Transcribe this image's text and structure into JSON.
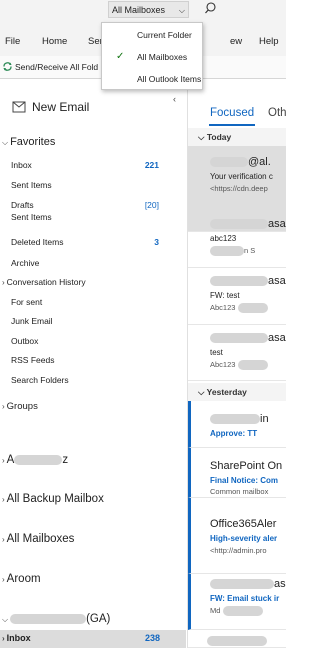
{
  "topbar": {
    "scope_label": "All Mailboxes",
    "scope_chevron": "chevron-down-icon",
    "search_icon": "search-icon"
  },
  "ribbon": {
    "tabs": [
      "File",
      "Home",
      "Sen",
      "ew",
      "Help"
    ],
    "send_receive_label": "Send/Receive All Fold"
  },
  "dropdown": {
    "items": [
      {
        "label": "Current Folder",
        "checked": false
      },
      {
        "label": "All Mailboxes",
        "checked": true
      },
      {
        "label": "All Outlook Items",
        "checked": false
      }
    ]
  },
  "folder_pane": {
    "new_email_label": "New Email",
    "favorites_label": "Favorites",
    "favorites": [
      {
        "label": "Inbox",
        "count": "221"
      },
      {
        "label": "Sent Items",
        "count": ""
      },
      {
        "label": "Drafts",
        "count": "[20]"
      },
      {
        "label": "Sent Items",
        "count": ""
      },
      {
        "label": "Deleted Items",
        "count": "3"
      },
      {
        "label": "Archive",
        "count": ""
      },
      {
        "label": "Conversation History",
        "count": ""
      },
      {
        "label": "For sent",
        "count": ""
      },
      {
        "label": "Junk Email",
        "count": ""
      },
      {
        "label": "Outbox",
        "count": ""
      },
      {
        "label": "RSS Feeds",
        "count": ""
      },
      {
        "label": "Search Folders",
        "count": ""
      }
    ],
    "groups_label": "Groups",
    "accounts": [
      {
        "prefix": "A",
        "suffix": "z"
      },
      {
        "prefix": "All Backup Mailbox",
        "suffix": ""
      },
      {
        "prefix": "All Mailboxes",
        "suffix": ""
      },
      {
        "prefix": "Aroom",
        "suffix": ""
      },
      {
        "prefix": "",
        "suffix": "(GA)"
      }
    ],
    "selected_inbox": {
      "label": "Inbox",
      "count": "238"
    }
  },
  "message_list": {
    "tab_focused": "Focused",
    "tab_other": "Oth",
    "today_label": "Today",
    "yesterday_label": "Yesterday",
    "today_messages": [
      {
        "sender_suffix": "@al.",
        "subject": "Your verification c",
        "preview": "<https://cdn.deep"
      },
      {
        "sender_suffix": "asa",
        "subject": "abc123",
        "preview": "n S"
      },
      {
        "sender_suffix": "asa",
        "subject": "FW: test",
        "preview": "Abc123"
      },
      {
        "sender_suffix": "asa",
        "subject": "test",
        "preview": "Abc123"
      }
    ],
    "yesterday_messages": [
      {
        "sender": "in",
        "subject": "Approve: TT",
        "preview": ""
      },
      {
        "sender": "SharePoint On",
        "subject": "Final Notice: Com",
        "preview": "Common mailbox"
      },
      {
        "sender": "Office365Aler",
        "subject": "High-severity aler",
        "preview": "<http://admin.pro"
      },
      {
        "sender": "asa",
        "subject": "FW: Email stuck ir",
        "preview": "Md"
      }
    ]
  }
}
